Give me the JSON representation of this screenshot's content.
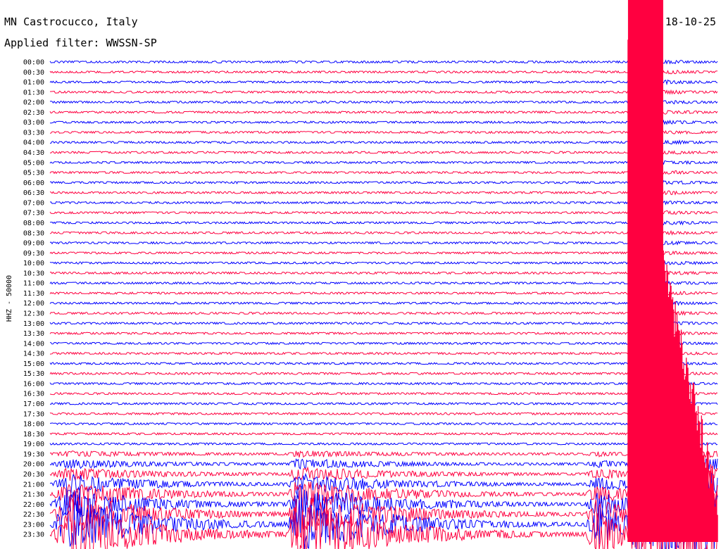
{
  "header": {
    "station": "MN Castrocucco, Italy",
    "filter": "Applied filter: WWSSN-SP",
    "date": "18-10-25"
  },
  "chart_data": {
    "type": "line",
    "title": "MN Castrocucco, Italy",
    "subtitle": "Applied filter: WWSSN-SP",
    "ylabel": "HHZ - 50000",
    "date": "18-10-25",
    "categories": [
      "00:00",
      "00:30",
      "01:00",
      "01:30",
      "02:00",
      "02:30",
      "03:00",
      "03:30",
      "04:00",
      "04:30",
      "05:00",
      "05:30",
      "06:00",
      "06:30",
      "07:00",
      "07:30",
      "08:00",
      "08:30",
      "09:00",
      "09:30",
      "10:00",
      "10:30",
      "11:00",
      "11:30",
      "12:00",
      "12:30",
      "13:00",
      "13:30",
      "14:00",
      "14:30",
      "15:00",
      "15:30",
      "16:00",
      "16:30",
      "17:00",
      "17:30",
      "18:00",
      "18:30",
      "19:00",
      "19:30",
      "20:00",
      "20:30",
      "21:00",
      "21:30",
      "22:00",
      "22:30",
      "23:00",
      "23:30"
    ],
    "colors": {
      "even": "#0000ff",
      "odd": "#ff0040"
    },
    "events": [
      {
        "name": "burst-1",
        "start": 0.0,
        "peak": 0.03,
        "decay": 0.12,
        "amp": 0.55
      },
      {
        "name": "burst-2",
        "start": 0.355,
        "peak": 0.37,
        "decay": 0.13,
        "amp": 0.65
      },
      {
        "name": "burst-3",
        "start": 0.8,
        "peak": 0.82,
        "decay": 0.05,
        "amp": 0.45
      },
      {
        "name": "saturated",
        "start": 0.865,
        "peak": 0.88,
        "decay": 0.25,
        "amp": 1.0
      }
    ]
  }
}
